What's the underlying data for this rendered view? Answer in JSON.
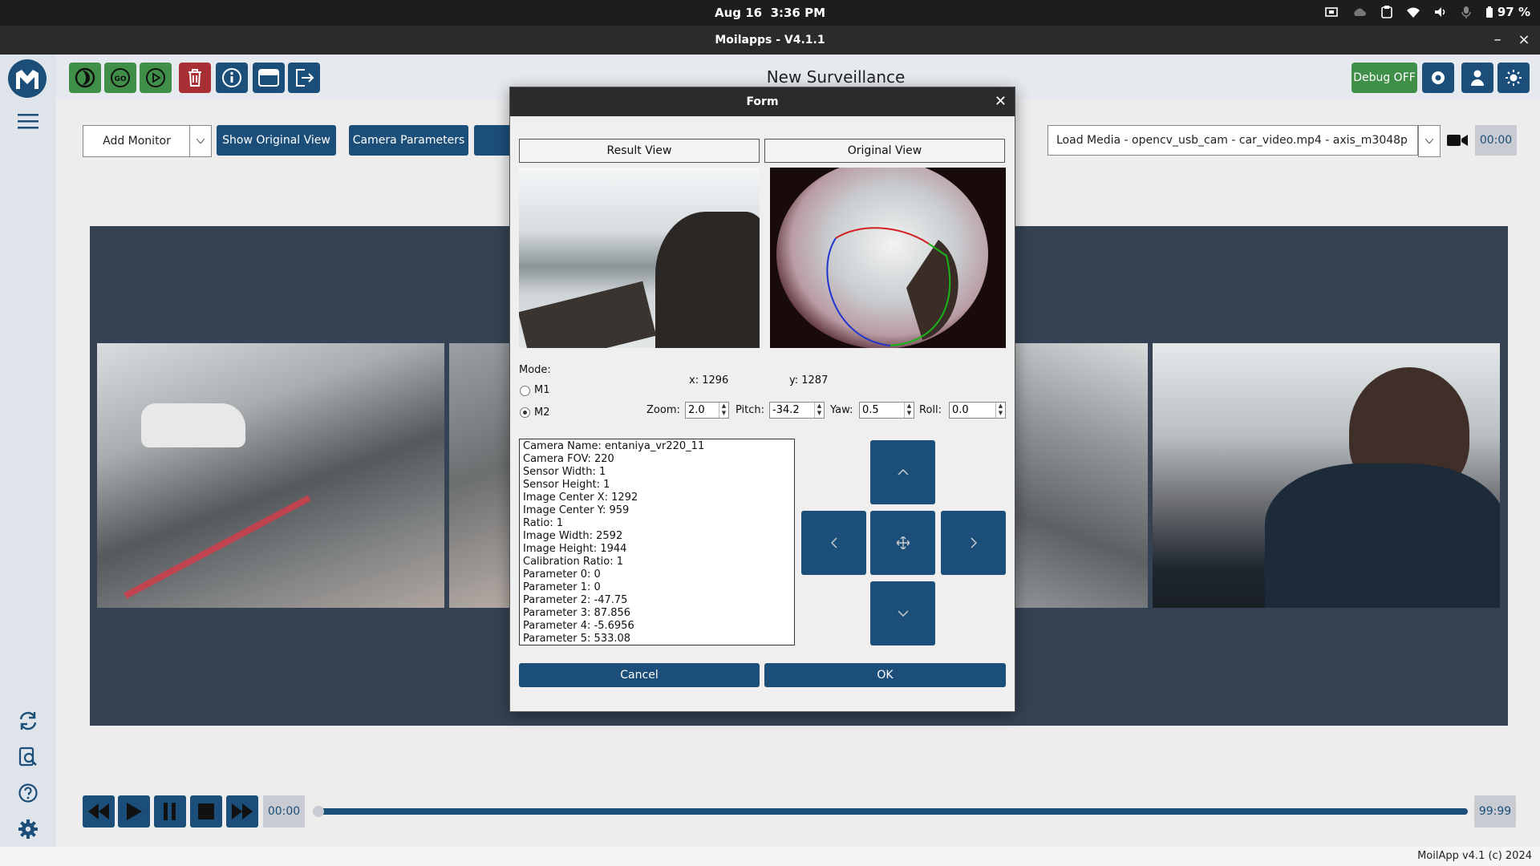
{
  "system": {
    "date": "Aug 16",
    "time": "3:36 PM",
    "battery": "97 %"
  },
  "window": {
    "title": "Moilapps - V4.1.1",
    "minimize": "–",
    "close": "×"
  },
  "header": {
    "title": "New Surveillance",
    "debug_label": "Debug OFF"
  },
  "toolbar": {
    "add_monitor": "Add Monitor",
    "show_original": "Show Original View",
    "camera_parameters": "Camera Parameters",
    "load_media": "Load Media - opencv_usb_cam - car_video.mp4 - axis_m3048p",
    "timer": "00:00"
  },
  "playback": {
    "current": "00:00",
    "end": "99:99",
    "progress": 0.0
  },
  "footer": {
    "text": "MoilApp v4.1 (c) 2024"
  },
  "dialog": {
    "title": "Form",
    "result_view": "Result View",
    "original_view": "Original View",
    "mode_label": "Mode:",
    "m1": "M1",
    "m2": "M2",
    "selected_mode": "M2",
    "coord_x": "x: 1296",
    "coord_y": "y: 1287",
    "zoom_label": "Zoom:",
    "zoom": "2.0",
    "pitch_label": "Pitch:",
    "pitch": "-34.2",
    "yaw_label": "Yaw:",
    "yaw": "0.5",
    "roll_label": "Roll:",
    "roll": "0.0",
    "params": [
      "Camera Name: entaniya_vr220_11",
      "Camera FOV: 220",
      "Sensor Width: 1",
      "Sensor Height: 1",
      "Image Center X: 1292",
      "Image Center Y: 959",
      "Ratio: 1",
      "Image Width: 2592",
      "Image Height: 1944",
      "Calibration Ratio: 1",
      "Parameter 0: 0",
      "Parameter 1: 0",
      "Parameter 2: -47.75",
      "Parameter 3: 87.856",
      "Parameter 4: -5.6956",
      "Parameter 5: 533.08"
    ],
    "cancel": "Cancel",
    "ok": "OK"
  },
  "colors": {
    "accent": "#1b4e78",
    "green": "#3f8f49",
    "red": "#a82f33",
    "monitor_bg": "#344253"
  }
}
